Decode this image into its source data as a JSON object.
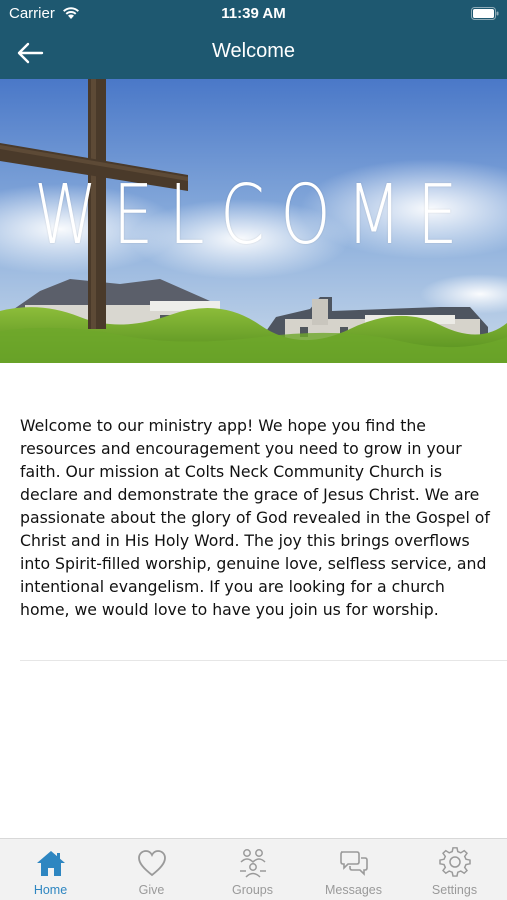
{
  "status_bar": {
    "carrier": "Carrier",
    "time": "11:39 AM"
  },
  "nav": {
    "title": "Welcome"
  },
  "hero": {
    "word": "WELCOME"
  },
  "content": {
    "body": "Welcome to our ministry app! We hope you find the resources and encouragement you need to grow in your faith. Our mission at Colts Neck Community Church is declare and demonstrate the grace of Jesus Christ. We are passionate about the glory of God revealed in the Gospel of Christ and in His Holy Word. The joy this brings overflows into Spirit-filled worship, genuine love, selfless service, and intentional evangelism. If you are looking for a church home, we would love to have you join us for worship."
  },
  "tabs": [
    {
      "label": "Home",
      "icon": "home-icon",
      "active": true
    },
    {
      "label": "Give",
      "icon": "heart-icon",
      "active": false
    },
    {
      "label": "Groups",
      "icon": "groups-icon",
      "active": false
    },
    {
      "label": "Messages",
      "icon": "messages-icon",
      "active": false
    },
    {
      "label": "Settings",
      "icon": "gear-icon",
      "active": false
    }
  ],
  "colors": {
    "header": "#1e5870",
    "tab_active": "#2e86c1",
    "tab_inactive": "#9a9a9a",
    "tab_bar": "#f2f2f2"
  }
}
